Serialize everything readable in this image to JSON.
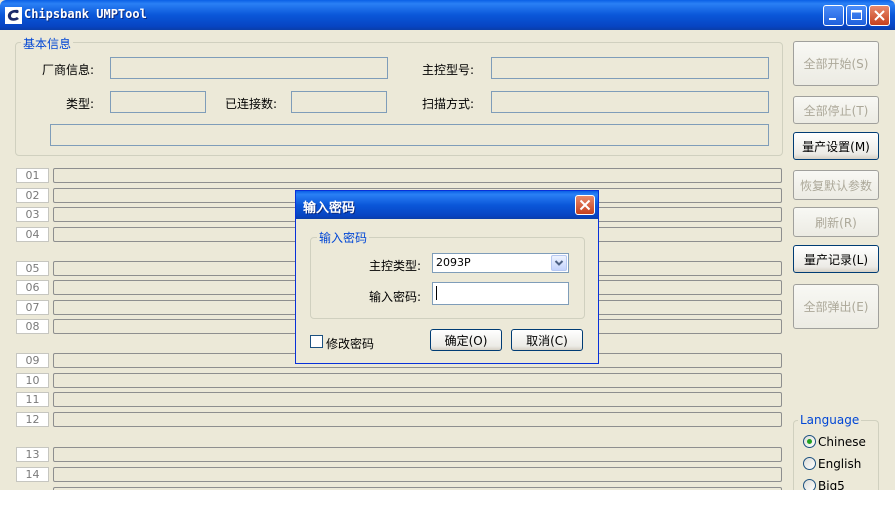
{
  "window": {
    "title": "Chipsbank UMPTool"
  },
  "basic_info": {
    "legend": "基本信息",
    "vendor_label": "厂商信息:",
    "controller_label": "主控型号:",
    "type_label": "类型:",
    "connected_label": "已连接数:",
    "scan_label": "扫描方式:"
  },
  "side_buttons": {
    "start_all": "全部开始(S)",
    "stop_all": "全部停止(T)",
    "mp_settings": "量产设置(M)",
    "restore_defaults": "恢复默认参数",
    "refresh": "刷新(R)",
    "mp_log": "量产记录(L)",
    "eject_all": "全部弹出(E)"
  },
  "ports": [
    "01",
    "02",
    "03",
    "04",
    "05",
    "06",
    "07",
    "08",
    "09",
    "10",
    "11",
    "12",
    "13",
    "14"
  ],
  "language": {
    "legend": "Language",
    "options": [
      "Chinese",
      "English",
      "Big5"
    ],
    "selected": "Chinese"
  },
  "dialog": {
    "title": "输入密码",
    "group_legend": "输入密码",
    "controller_type_label": "主控类型:",
    "controller_type_value": "2093P",
    "password_label": "输入密码:",
    "password_value": "",
    "change_password_label": "修改密码",
    "ok_label": "确定(O)",
    "cancel_label": "取消(C)"
  },
  "icons": {
    "app": "chipsbank-logo-icon",
    "minimize": "minimize-icon",
    "maximize": "maximize-icon",
    "close": "close-icon",
    "dropdown": "chevron-down-icon"
  }
}
